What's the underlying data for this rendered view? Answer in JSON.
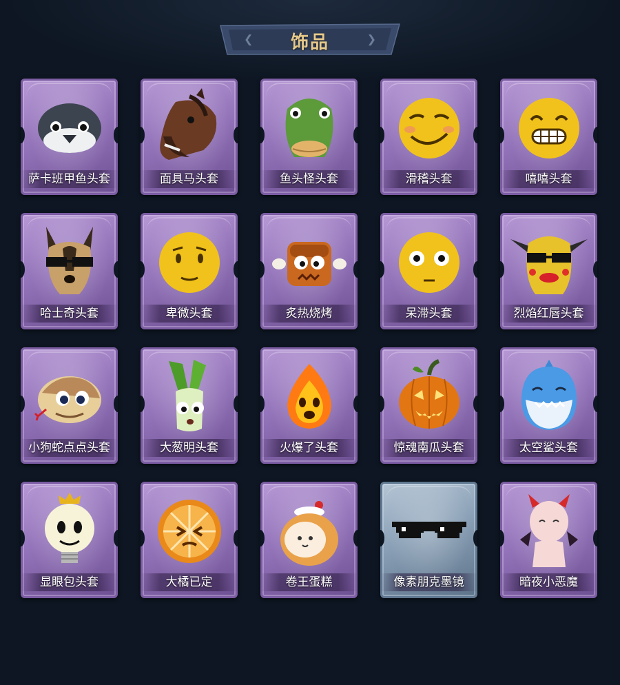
{
  "header": {
    "title": "饰品"
  },
  "items": [
    {
      "label": "萨卡班甲鱼头套",
      "icon": "armored-fish-icon",
      "rarity": "purple"
    },
    {
      "label": "面具马头套",
      "icon": "horse-mask-icon",
      "rarity": "purple"
    },
    {
      "label": "鱼头怪头套",
      "icon": "fish-head-icon",
      "rarity": "purple"
    },
    {
      "label": "滑稽头套",
      "icon": "smirk-emoji-icon",
      "rarity": "purple"
    },
    {
      "label": "嘻嘻头套",
      "icon": "grin-emoji-icon",
      "rarity": "purple"
    },
    {
      "label": "哈士奇头套",
      "icon": "husky-icon",
      "rarity": "purple"
    },
    {
      "label": "卑微头套",
      "icon": "humble-emoji-icon",
      "rarity": "purple"
    },
    {
      "label": "炙热烧烤",
      "icon": "grilled-meat-icon",
      "rarity": "purple"
    },
    {
      "label": "呆滞头套",
      "icon": "dazed-emoji-icon",
      "rarity": "purple"
    },
    {
      "label": "烈焰红唇头套",
      "icon": "red-lips-mask-icon",
      "rarity": "purple"
    },
    {
      "label": "小狗蛇点点头套",
      "icon": "snake-icon",
      "rarity": "purple"
    },
    {
      "label": "大葱明头套",
      "icon": "scallion-icon",
      "rarity": "purple"
    },
    {
      "label": "火爆了头套",
      "icon": "fire-icon",
      "rarity": "purple"
    },
    {
      "label": "惊魂南瓜头套",
      "icon": "pumpkin-icon",
      "rarity": "purple"
    },
    {
      "label": "太空鲨头套",
      "icon": "shark-icon",
      "rarity": "purple"
    },
    {
      "label": "显眼包头套",
      "icon": "lightbulb-icon",
      "rarity": "purple"
    },
    {
      "label": "大橘已定",
      "icon": "orange-slice-icon",
      "rarity": "purple"
    },
    {
      "label": "卷王蛋糕",
      "icon": "roll-cake-icon",
      "rarity": "purple"
    },
    {
      "label": "像素朋克墨镜",
      "icon": "pixel-sunglasses-icon",
      "rarity": "blue"
    },
    {
      "label": "暗夜小恶魔",
      "icon": "little-devil-icon",
      "rarity": "purple"
    }
  ]
}
